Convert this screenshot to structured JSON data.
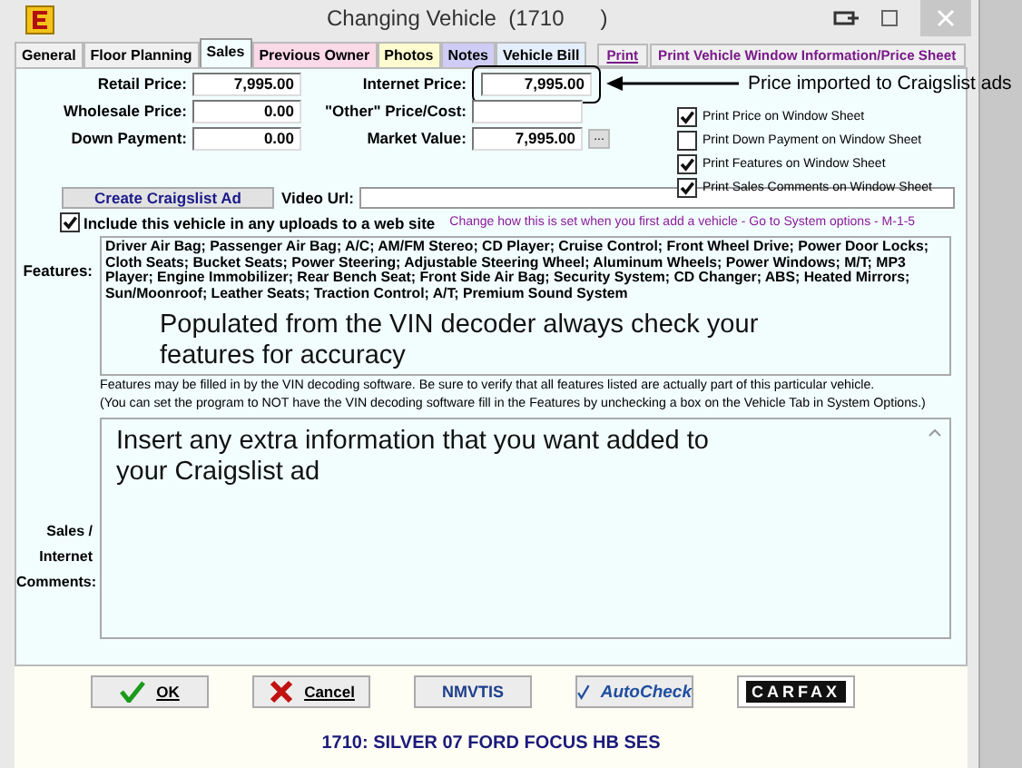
{
  "window": {
    "title": "Changing Vehicle  (1710      )"
  },
  "tabs": [
    {
      "label": "General",
      "selected": false,
      "color": "#f0f0f0"
    },
    {
      "label": "Floor Planning",
      "selected": false,
      "color": "#f0f0f0"
    },
    {
      "label": "Sales",
      "selected": true,
      "color": "#f2fdfd"
    },
    {
      "label": "Previous Owner",
      "selected": false,
      "color": "#fbd9e6"
    },
    {
      "label": "Photos",
      "selected": false,
      "color": "#fdfbcf"
    },
    {
      "label": "Notes",
      "selected": false,
      "color": "#cfcdf5"
    },
    {
      "label": "Vehicle Bill",
      "selected": false,
      "color": "#e4eefc"
    }
  ],
  "print_buttons": [
    "Print",
    "Print Vehicle Window Information/Price Sheet"
  ],
  "price_fields": [
    {
      "label": "Retail Price:",
      "value": "7,995.00",
      "highlighted": false
    },
    {
      "label": "Internet Price:",
      "value": "7,995.00",
      "highlighted": true
    },
    {
      "label": "Wholesale Price:",
      "value": "0.00",
      "highlighted": false
    },
    {
      "label": "\"Other\" Price/Cost:",
      "highlighted": false
    },
    {
      "label": "Down Payment:",
      "value": "0.00",
      "highlighted": false
    },
    {
      "label": "Market Value:",
      "value": "7,995.00",
      "highlighted": false
    }
  ],
  "market_value_button": "...",
  "callout": "Price imported to Craigslist ads",
  "window_sheet_options": [
    {
      "label": "Print Price on Window Sheet",
      "checked": true
    },
    {
      "label": "Print Down Payment on Window Sheet",
      "checked": false
    },
    {
      "label": "Print Features on Window Sheet",
      "checked": true
    },
    {
      "label": "Print Sales Comments on Window Sheet",
      "checked": true
    }
  ],
  "craigslist_button": "Create Craigslist Ad",
  "video_url": {
    "label": "Video Url:"
  },
  "include_upload": {
    "label": "Include this vehicle in any uploads to a web site",
    "checked": true
  },
  "system_options_link": "Change how this is set when you first add a vehicle - Go to System options - M-1-5",
  "features": {
    "label": "Features:",
    "value": "Driver Air Bag; Passenger Air Bag; A/C; AM/FM Stereo; CD Player; Cruise Control; Front Wheel Drive; Power Door Locks; Cloth Seats; Bucket Seats; Power Steering; Adjustable Steering Wheel; Aluminum Wheels; Power Windows; M/T; MP3 Player; Engine Immobilizer; Rear Bench Seat; Front Side Air Bag; Security System; CD Changer; ABS; Heated Mirrors; Sun/Moonroof; Leather Seats; Traction Control; A/T; Premium Sound System",
    "annotation": "Populated from the VIN decoder always check your features for accuracy"
  },
  "features_notes": [
    "Features may be filled in by the VIN decoding software.  Be sure to verify that all features listed are actually part of this particular vehicle.",
    "(You can set the program to NOT have the VIN decoding software  fill in the Features by unchecking a box on the Vehicle Tab in System Options.)"
  ],
  "sales_comments": {
    "label": "Sales / Internet Comments:",
    "value": "Insert any extra information that you want added to your Craigslist ad"
  },
  "buttons": [
    {
      "kind": "ok",
      "label": "OK"
    },
    {
      "kind": "cancel",
      "label": "Cancel"
    },
    {
      "kind": "nmvtis",
      "label": "NMVTIS"
    },
    {
      "kind": "autocheck",
      "label": "AutoCheck"
    },
    {
      "kind": "carfax",
      "label": "CARFAX"
    }
  ],
  "footer": "1710: SILVER 07 FORD FOCUS HB SES"
}
